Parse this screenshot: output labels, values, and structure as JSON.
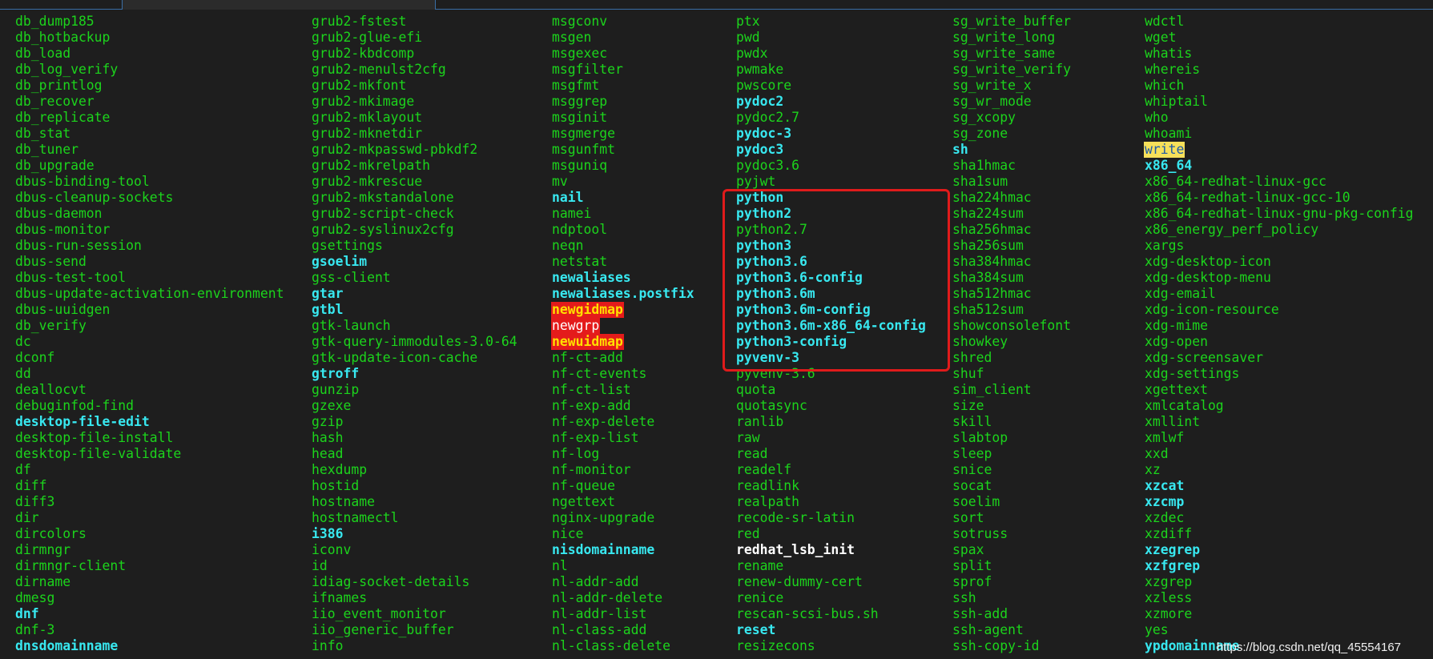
{
  "watermark": "https://blog.csdn.net/qq_45554167",
  "columns": [
    [
      {
        "t": "db_dump185",
        "s": "g"
      },
      {
        "t": "db_hotbackup",
        "s": "g"
      },
      {
        "t": "db_load",
        "s": "g"
      },
      {
        "t": "db_log_verify",
        "s": "g"
      },
      {
        "t": "db_printlog",
        "s": "g"
      },
      {
        "t": "db_recover",
        "s": "g"
      },
      {
        "t": "db_replicate",
        "s": "g"
      },
      {
        "t": "db_stat",
        "s": "g"
      },
      {
        "t": "db_tuner",
        "s": "g"
      },
      {
        "t": "db_upgrade",
        "s": "g"
      },
      {
        "t": "dbus-binding-tool",
        "s": "g"
      },
      {
        "t": "dbus-cleanup-sockets",
        "s": "g"
      },
      {
        "t": "dbus-daemon",
        "s": "g"
      },
      {
        "t": "dbus-monitor",
        "s": "g"
      },
      {
        "t": "dbus-run-session",
        "s": "g"
      },
      {
        "t": "dbus-send",
        "s": "g"
      },
      {
        "t": "dbus-test-tool",
        "s": "g"
      },
      {
        "t": "dbus-update-activation-environment",
        "s": "g"
      },
      {
        "t": "dbus-uuidgen",
        "s": "g"
      },
      {
        "t": "db_verify",
        "s": "g"
      },
      {
        "t": "dc",
        "s": "g"
      },
      {
        "t": "dconf",
        "s": "g"
      },
      {
        "t": "dd",
        "s": "g"
      },
      {
        "t": "deallocvt",
        "s": "g"
      },
      {
        "t": "debuginfod-find",
        "s": "g"
      },
      {
        "t": "desktop-file-edit",
        "s": "c"
      },
      {
        "t": "desktop-file-install",
        "s": "g"
      },
      {
        "t": "desktop-file-validate",
        "s": "g"
      },
      {
        "t": "df",
        "s": "g"
      },
      {
        "t": "diff",
        "s": "g"
      },
      {
        "t": "diff3",
        "s": "g"
      },
      {
        "t": "dir",
        "s": "g"
      },
      {
        "t": "dircolors",
        "s": "g"
      },
      {
        "t": "dirmngr",
        "s": "g"
      },
      {
        "t": "dirmngr-client",
        "s": "g"
      },
      {
        "t": "dirname",
        "s": "g"
      },
      {
        "t": "dmesg",
        "s": "g"
      },
      {
        "t": "dnf",
        "s": "c"
      },
      {
        "t": "dnf-3",
        "s": "g"
      },
      {
        "t": "dnsdomainname",
        "s": "c"
      }
    ],
    [
      {
        "t": "grub2-fstest",
        "s": "g"
      },
      {
        "t": "grub2-glue-efi",
        "s": "g"
      },
      {
        "t": "grub2-kbdcomp",
        "s": "g"
      },
      {
        "t": "grub2-menulst2cfg",
        "s": "g"
      },
      {
        "t": "grub2-mkfont",
        "s": "g"
      },
      {
        "t": "grub2-mkimage",
        "s": "g"
      },
      {
        "t": "grub2-mklayout",
        "s": "g"
      },
      {
        "t": "grub2-mknetdir",
        "s": "g"
      },
      {
        "t": "grub2-mkpasswd-pbkdf2",
        "s": "g"
      },
      {
        "t": "grub2-mkrelpath",
        "s": "g"
      },
      {
        "t": "grub2-mkrescue",
        "s": "g"
      },
      {
        "t": "grub2-mkstandalone",
        "s": "g"
      },
      {
        "t": "grub2-script-check",
        "s": "g"
      },
      {
        "t": "grub2-syslinux2cfg",
        "s": "g"
      },
      {
        "t": "gsettings",
        "s": "g"
      },
      {
        "t": "gsoelim",
        "s": "c"
      },
      {
        "t": "gss-client",
        "s": "g"
      },
      {
        "t": "gtar",
        "s": "c"
      },
      {
        "t": "gtbl",
        "s": "c"
      },
      {
        "t": "gtk-launch",
        "s": "g"
      },
      {
        "t": "gtk-query-immodules-3.0-64",
        "s": "g"
      },
      {
        "t": "gtk-update-icon-cache",
        "s": "g"
      },
      {
        "t": "gtroff",
        "s": "c"
      },
      {
        "t": "gunzip",
        "s": "g"
      },
      {
        "t": "gzexe",
        "s": "g"
      },
      {
        "t": "gzip",
        "s": "g"
      },
      {
        "t": "hash",
        "s": "g"
      },
      {
        "t": "head",
        "s": "g"
      },
      {
        "t": "hexdump",
        "s": "g"
      },
      {
        "t": "hostid",
        "s": "g"
      },
      {
        "t": "hostname",
        "s": "g"
      },
      {
        "t": "hostnamectl",
        "s": "g"
      },
      {
        "t": "i386",
        "s": "c"
      },
      {
        "t": "iconv",
        "s": "g"
      },
      {
        "t": "id",
        "s": "g"
      },
      {
        "t": "idiag-socket-details",
        "s": "g"
      },
      {
        "t": "ifnames",
        "s": "g"
      },
      {
        "t": "iio_event_monitor",
        "s": "g"
      },
      {
        "t": "iio_generic_buffer",
        "s": "g"
      },
      {
        "t": "info",
        "s": "g"
      }
    ],
    [
      {
        "t": "msgconv",
        "s": "g"
      },
      {
        "t": "msgen",
        "s": "g"
      },
      {
        "t": "msgexec",
        "s": "g"
      },
      {
        "t": "msgfilter",
        "s": "g"
      },
      {
        "t": "msgfmt",
        "s": "g"
      },
      {
        "t": "msggrep",
        "s": "g"
      },
      {
        "t": "msginit",
        "s": "g"
      },
      {
        "t": "msgmerge",
        "s": "g"
      },
      {
        "t": "msgunfmt",
        "s": "g"
      },
      {
        "t": "msguniq",
        "s": "g"
      },
      {
        "t": "mv",
        "s": "g"
      },
      {
        "t": "nail",
        "s": "c"
      },
      {
        "t": "namei",
        "s": "g"
      },
      {
        "t": "ndptool",
        "s": "g"
      },
      {
        "t": "neqn",
        "s": "g"
      },
      {
        "t": "netstat",
        "s": "g"
      },
      {
        "t": "newaliases",
        "s": "c"
      },
      {
        "t": "newaliases.postfix",
        "s": "c"
      },
      {
        "t": "newgidmap",
        "s": "hlr"
      },
      {
        "t": "newgrp",
        "s": "hlr2"
      },
      {
        "t": "newuidmap",
        "s": "hlr"
      },
      {
        "t": "nf-ct-add",
        "s": "g"
      },
      {
        "t": "nf-ct-events",
        "s": "g"
      },
      {
        "t": "nf-ct-list",
        "s": "g"
      },
      {
        "t": "nf-exp-add",
        "s": "g"
      },
      {
        "t": "nf-exp-delete",
        "s": "g"
      },
      {
        "t": "nf-exp-list",
        "s": "g"
      },
      {
        "t": "nf-log",
        "s": "g"
      },
      {
        "t": "nf-monitor",
        "s": "g"
      },
      {
        "t": "nf-queue",
        "s": "g"
      },
      {
        "t": "ngettext",
        "s": "g"
      },
      {
        "t": "nginx-upgrade",
        "s": "g"
      },
      {
        "t": "nice",
        "s": "g"
      },
      {
        "t": "nisdomainname",
        "s": "c"
      },
      {
        "t": "nl",
        "s": "g"
      },
      {
        "t": "nl-addr-add",
        "s": "g"
      },
      {
        "t": "nl-addr-delete",
        "s": "g"
      },
      {
        "t": "nl-addr-list",
        "s": "g"
      },
      {
        "t": "nl-class-add",
        "s": "g"
      },
      {
        "t": "nl-class-delete",
        "s": "g"
      }
    ],
    [
      {
        "t": "ptx",
        "s": "g"
      },
      {
        "t": "pwd",
        "s": "g"
      },
      {
        "t": "pwdx",
        "s": "g"
      },
      {
        "t": "pwmake",
        "s": "g"
      },
      {
        "t": "pwscore",
        "s": "g"
      },
      {
        "t": "pydoc2",
        "s": "c"
      },
      {
        "t": "pydoc2.7",
        "s": "g"
      },
      {
        "t": "pydoc-3",
        "s": "c"
      },
      {
        "t": "pydoc3",
        "s": "c"
      },
      {
        "t": "pydoc3.6",
        "s": "g"
      },
      {
        "t": "pyjwt",
        "s": "g"
      },
      {
        "t": "python",
        "s": "c"
      },
      {
        "t": "python2",
        "s": "c"
      },
      {
        "t": "python2.7",
        "s": "g"
      },
      {
        "t": "python3",
        "s": "c"
      },
      {
        "t": "python3.6",
        "s": "c"
      },
      {
        "t": "python3.6-config",
        "s": "c"
      },
      {
        "t": "python3.6m",
        "s": "c"
      },
      {
        "t": "python3.6m-config",
        "s": "c"
      },
      {
        "t": "python3.6m-x86_64-config",
        "s": "c"
      },
      {
        "t": "python3-config",
        "s": "c"
      },
      {
        "t": "pyvenv-3",
        "s": "c"
      },
      {
        "t": "pyvenv-3.6",
        "s": "g"
      },
      {
        "t": "quota",
        "s": "g"
      },
      {
        "t": "quotasync",
        "s": "g"
      },
      {
        "t": "ranlib",
        "s": "g"
      },
      {
        "t": "raw",
        "s": "g"
      },
      {
        "t": "read",
        "s": "g"
      },
      {
        "t": "readelf",
        "s": "g"
      },
      {
        "t": "readlink",
        "s": "g"
      },
      {
        "t": "realpath",
        "s": "g"
      },
      {
        "t": "recode-sr-latin",
        "s": "g"
      },
      {
        "t": "red",
        "s": "g"
      },
      {
        "t": "redhat_lsb_init",
        "s": "w"
      },
      {
        "t": "rename",
        "s": "g"
      },
      {
        "t": "renew-dummy-cert",
        "s": "g"
      },
      {
        "t": "renice",
        "s": "g"
      },
      {
        "t": "rescan-scsi-bus.sh",
        "s": "g"
      },
      {
        "t": "reset",
        "s": "c"
      },
      {
        "t": "resizecons",
        "s": "g"
      }
    ],
    [
      {
        "t": "sg_write_buffer",
        "s": "g"
      },
      {
        "t": "sg_write_long",
        "s": "g"
      },
      {
        "t": "sg_write_same",
        "s": "g"
      },
      {
        "t": "sg_write_verify",
        "s": "g"
      },
      {
        "t": "sg_write_x",
        "s": "g"
      },
      {
        "t": "sg_wr_mode",
        "s": "g"
      },
      {
        "t": "sg_xcopy",
        "s": "g"
      },
      {
        "t": "sg_zone",
        "s": "g"
      },
      {
        "t": "sh",
        "s": "c"
      },
      {
        "t": "sha1hmac",
        "s": "g"
      },
      {
        "t": "sha1sum",
        "s": "g"
      },
      {
        "t": "sha224hmac",
        "s": "g"
      },
      {
        "t": "sha224sum",
        "s": "g"
      },
      {
        "t": "sha256hmac",
        "s": "g"
      },
      {
        "t": "sha256sum",
        "s": "g"
      },
      {
        "t": "sha384hmac",
        "s": "g"
      },
      {
        "t": "sha384sum",
        "s": "g"
      },
      {
        "t": "sha512hmac",
        "s": "g"
      },
      {
        "t": "sha512sum",
        "s": "g"
      },
      {
        "t": "showconsolefont",
        "s": "g"
      },
      {
        "t": "showkey",
        "s": "g"
      },
      {
        "t": "shred",
        "s": "g"
      },
      {
        "t": "shuf",
        "s": "g"
      },
      {
        "t": "sim_client",
        "s": "g"
      },
      {
        "t": "size",
        "s": "g"
      },
      {
        "t": "skill",
        "s": "g"
      },
      {
        "t": "slabtop",
        "s": "g"
      },
      {
        "t": "sleep",
        "s": "g"
      },
      {
        "t": "snice",
        "s": "g"
      },
      {
        "t": "socat",
        "s": "g"
      },
      {
        "t": "soelim",
        "s": "g"
      },
      {
        "t": "sort",
        "s": "g"
      },
      {
        "t": "sotruss",
        "s": "g"
      },
      {
        "t": "spax",
        "s": "g"
      },
      {
        "t": "split",
        "s": "g"
      },
      {
        "t": "sprof",
        "s": "g"
      },
      {
        "t": "ssh",
        "s": "g"
      },
      {
        "t": "ssh-add",
        "s": "g"
      },
      {
        "t": "ssh-agent",
        "s": "g"
      },
      {
        "t": "ssh-copy-id",
        "s": "g"
      }
    ],
    [
      {
        "t": "wdctl",
        "s": "g"
      },
      {
        "t": "wget",
        "s": "g"
      },
      {
        "t": "whatis",
        "s": "g"
      },
      {
        "t": "whereis",
        "s": "g"
      },
      {
        "t": "which",
        "s": "g"
      },
      {
        "t": "whiptail",
        "s": "g"
      },
      {
        "t": "who",
        "s": "g"
      },
      {
        "t": "whoami",
        "s": "g"
      },
      {
        "t": "write",
        "s": "hly"
      },
      {
        "t": "x86_64",
        "s": "c"
      },
      {
        "t": "x86_64-redhat-linux-gcc",
        "s": "g"
      },
      {
        "t": "x86_64-redhat-linux-gcc-10",
        "s": "g"
      },
      {
        "t": "x86_64-redhat-linux-gnu-pkg-config",
        "s": "g"
      },
      {
        "t": "x86_energy_perf_policy",
        "s": "g"
      },
      {
        "t": "xargs",
        "s": "g"
      },
      {
        "t": "xdg-desktop-icon",
        "s": "g"
      },
      {
        "t": "xdg-desktop-menu",
        "s": "g"
      },
      {
        "t": "xdg-email",
        "s": "g"
      },
      {
        "t": "xdg-icon-resource",
        "s": "g"
      },
      {
        "t": "xdg-mime",
        "s": "g"
      },
      {
        "t": "xdg-open",
        "s": "g"
      },
      {
        "t": "xdg-screensaver",
        "s": "g"
      },
      {
        "t": "xdg-settings",
        "s": "g"
      },
      {
        "t": "xgettext",
        "s": "g"
      },
      {
        "t": "xmlcatalog",
        "s": "g"
      },
      {
        "t": "xmllint",
        "s": "g"
      },
      {
        "t": "xmlwf",
        "s": "g"
      },
      {
        "t": "xxd",
        "s": "g"
      },
      {
        "t": "xz",
        "s": "g"
      },
      {
        "t": "xzcat",
        "s": "c"
      },
      {
        "t": "xzcmp",
        "s": "c"
      },
      {
        "t": "xzdec",
        "s": "g"
      },
      {
        "t": "xzdiff",
        "s": "g"
      },
      {
        "t": "xzegrep",
        "s": "c"
      },
      {
        "t": "xzfgrep",
        "s": "c"
      },
      {
        "t": "xzgrep",
        "s": "g"
      },
      {
        "t": "xzless",
        "s": "g"
      },
      {
        "t": "xzmore",
        "s": "g"
      },
      {
        "t": "yes",
        "s": "g"
      },
      {
        "t": "ypdomainname",
        "s": "c"
      }
    ]
  ]
}
